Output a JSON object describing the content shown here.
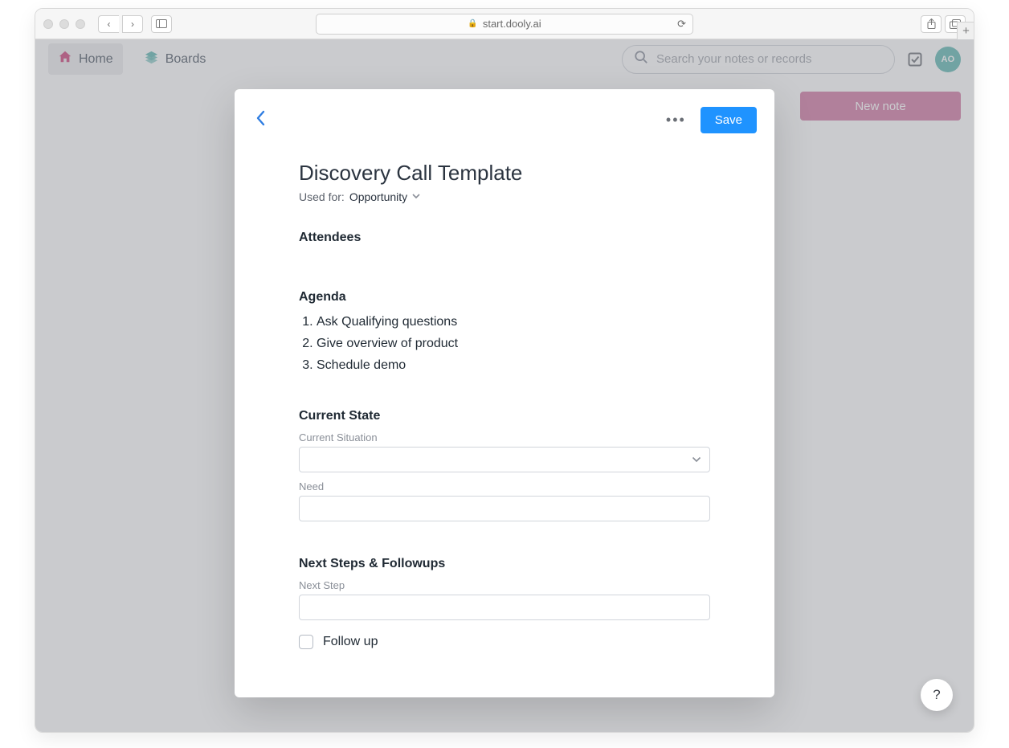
{
  "browser": {
    "url": "start.dooly.ai"
  },
  "app": {
    "nav": {
      "home": "Home",
      "boards": "Boards"
    },
    "search_placeholder": "Search your notes or records",
    "avatar_initials": "AO",
    "new_note_label": "New note"
  },
  "modal": {
    "save_label": "Save",
    "title": "Discovery Call Template",
    "used_for_label": "Used for:",
    "used_for_type": "Opportunity",
    "sections": {
      "attendees_h": "Attendees",
      "agenda_h": "Agenda",
      "agenda_items": {
        "0": "Ask Qualifying questions",
        "1": "Give overview of product",
        "2": "Schedule demo"
      },
      "current_state_h": "Current State",
      "current_situation_label": "Current Situation",
      "need_label": "Need",
      "next_steps_h": "Next Steps & Followups",
      "next_step_label": "Next Step",
      "follow_up_label": "Follow up"
    }
  },
  "help": "?"
}
